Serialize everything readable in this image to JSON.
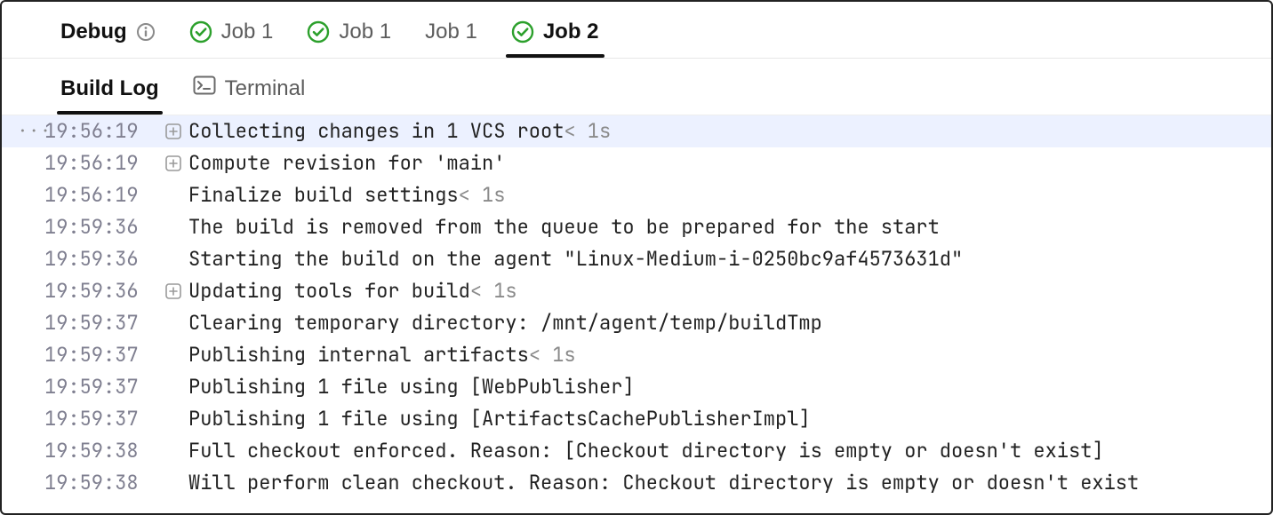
{
  "tabs": {
    "debug_label": "Debug",
    "items": [
      {
        "label": "Job 1",
        "status": "success"
      },
      {
        "label": "Job 1",
        "status": "success"
      },
      {
        "label": "Job 1",
        "status": "none"
      },
      {
        "label": "Job 2",
        "status": "success",
        "active": true
      }
    ]
  },
  "subtabs": {
    "build_log_label": "Build Log",
    "terminal_label": "Terminal"
  },
  "log": [
    {
      "ts": "19:56:19",
      "expand": true,
      "msg": "Collecting changes in 1 VCS root",
      "dur": "< 1s",
      "highlight": true,
      "has_dots": true
    },
    {
      "ts": "19:56:19",
      "expand": true,
      "msg": "Compute revision for 'main'"
    },
    {
      "ts": "19:56:19",
      "expand": false,
      "msg": "Finalize build settings",
      "dur": "< 1s"
    },
    {
      "ts": "19:59:36",
      "expand": false,
      "msg": "The build is removed from the queue to be prepared for the start"
    },
    {
      "ts": "19:59:36",
      "expand": false,
      "msg": "Starting the build on the agent \"Linux-Medium-i-0250bc9af4573631d\""
    },
    {
      "ts": "19:59:36",
      "expand": true,
      "msg": "Updating tools for build",
      "dur": "< 1s"
    },
    {
      "ts": "19:59:37",
      "expand": false,
      "msg": "Clearing temporary directory: /mnt/agent/temp/buildTmp"
    },
    {
      "ts": "19:59:37",
      "expand": false,
      "msg": "Publishing internal artifacts",
      "dur": "< 1s"
    },
    {
      "ts": "19:59:37",
      "expand": false,
      "msg": "Publishing 1 file using [WebPublisher]"
    },
    {
      "ts": "19:59:37",
      "expand": false,
      "msg": "Publishing 1 file using [ArtifactsCachePublisherImpl]"
    },
    {
      "ts": "19:59:38",
      "expand": false,
      "msg": "Full checkout enforced. Reason: [Checkout directory is empty or doesn't exist]"
    },
    {
      "ts": "19:59:38",
      "expand": false,
      "msg": "Will perform clean checkout. Reason: Checkout directory is empty or doesn't exist"
    }
  ],
  "colors": {
    "success": "#2ca02c"
  }
}
